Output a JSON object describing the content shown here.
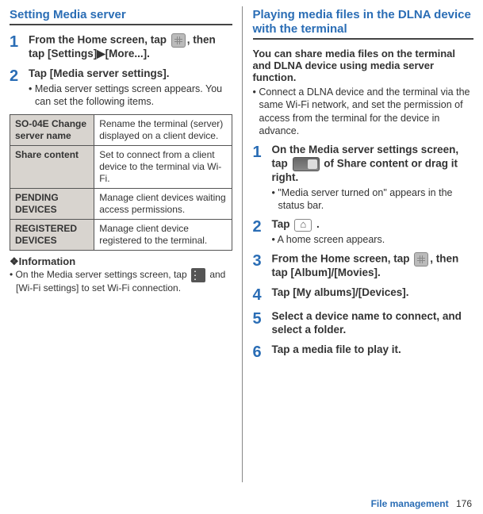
{
  "left": {
    "title": "Setting Media server",
    "step1": {
      "num": "1",
      "line1": "From the Home screen, tap ",
      "line2": ", then tap [Settings]",
      "line3": "[More...].",
      "arrow": "▶"
    },
    "step2": {
      "num": "2",
      "main": "Tap [Media server settings].",
      "sub": "Media server settings screen appears. You can set the following items."
    },
    "table": {
      "r1a": "SO-04E Change server name",
      "r1b": "Rename the terminal (server) displayed on a client device.",
      "r2a": "Share content",
      "r2b": "Set to connect from a client device to the terminal via Wi-Fi.",
      "r3a": "PENDING DEVICES",
      "r3b": "Manage client devices waiting access permissions.",
      "r4a": "REGISTERED DEVICES",
      "r4b": "Manage client device registered to the terminal."
    },
    "info_head": "❖Information",
    "info_body_a": "On the Media server settings screen, tap ",
    "info_body_b": " and [Wi-Fi settings] to set Wi-Fi connection."
  },
  "right": {
    "title": "Playing media files in the DLNA device with the terminal",
    "intro": "You can share media files on the terminal and DLNA device using media server function.",
    "note": "Connect a DLNA device and the terminal via the same Wi-Fi network, and set the permission of access from the terminal for the device in advance.",
    "step1": {
      "num": "1",
      "main_a": "On the Media server settings screen, tap ",
      "main_b": " of Share content or drag it right.",
      "sub": "\"Media server turned on\" appears in the status bar."
    },
    "step2": {
      "num": "2",
      "main_a": "Tap ",
      "main_b": " .",
      "sub": "A home screen appears."
    },
    "step3": {
      "num": "3",
      "main_a": "From the Home screen, tap ",
      "main_b": ", then tap [Album]/[Movies]."
    },
    "step4": {
      "num": "4",
      "main": "Tap [My albums]/[Devices]."
    },
    "step5": {
      "num": "5",
      "main": "Select a device name to connect, and select a folder."
    },
    "step6": {
      "num": "6",
      "main": "Tap a media file to play it."
    }
  },
  "footer": {
    "label": "File management",
    "page": "176"
  }
}
